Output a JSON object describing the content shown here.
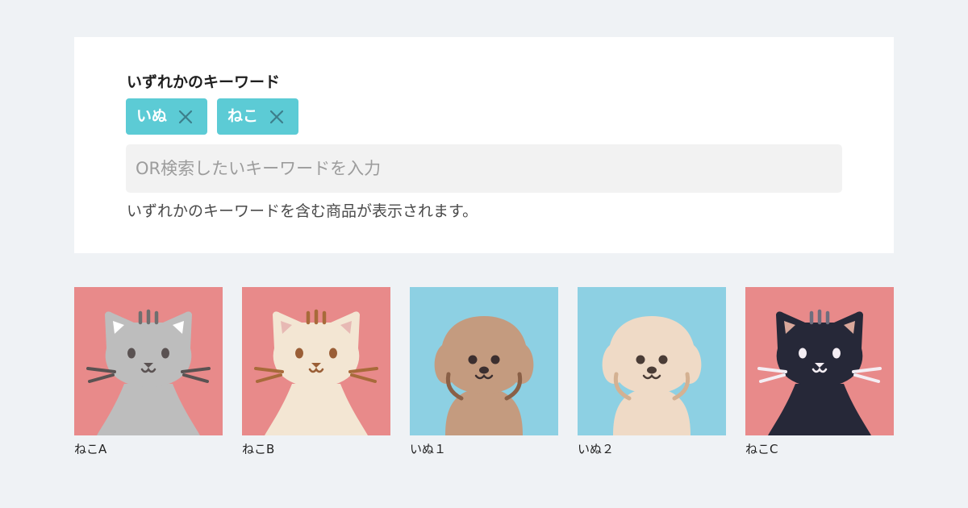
{
  "filter": {
    "title": "いずれかのキーワード",
    "chips": [
      {
        "label": "いぬ"
      },
      {
        "label": "ねこ"
      }
    ],
    "input_placeholder": "OR検索したいキーワードを入力",
    "helper_text": "いずれかのキーワードを含む商品が表示されます。"
  },
  "products": [
    {
      "name": "ねこA",
      "animal": "cat",
      "bg": "#e88a8a",
      "fur": "#bdbdbd",
      "stripe": "#6f6f6f",
      "ear_inner": "#ffffff",
      "eye": "#5a5252",
      "whisker": "#5a5252"
    },
    {
      "name": "ねこB",
      "animal": "cat",
      "bg": "#e88a8a",
      "fur": "#f3e6d3",
      "stripe": "#a86a3a",
      "ear_inner": "#e7b9b4",
      "eye": "#9a5e36",
      "whisker": "#a86a3a"
    },
    {
      "name": "いぬ１",
      "animal": "dog",
      "bg": "#8dd0e3",
      "fur": "#c49b7f",
      "ear_line": "#8a6047",
      "eye": "#3c2f2f"
    },
    {
      "name": "いぬ２",
      "animal": "dog",
      "bg": "#8dd0e3",
      "fur": "#efdac6",
      "ear_line": "#d4b192",
      "eye": "#4a3c36"
    },
    {
      "name": "ねこC",
      "animal": "cat",
      "bg": "#e88a8a",
      "fur": "#262838",
      "stripe": "#6e6e7e",
      "ear_inner": "#d9a89b",
      "eye": "#f4eef4",
      "whisker": "#f4eef4"
    }
  ],
  "colors": {
    "page_bg": "#eff2f5",
    "chip_bg": "#5ccbd5",
    "chip_close": "#3c7f8c",
    "input_bg": "#f2f2f2"
  },
  "icons": {
    "chip_close": "close-icon"
  }
}
